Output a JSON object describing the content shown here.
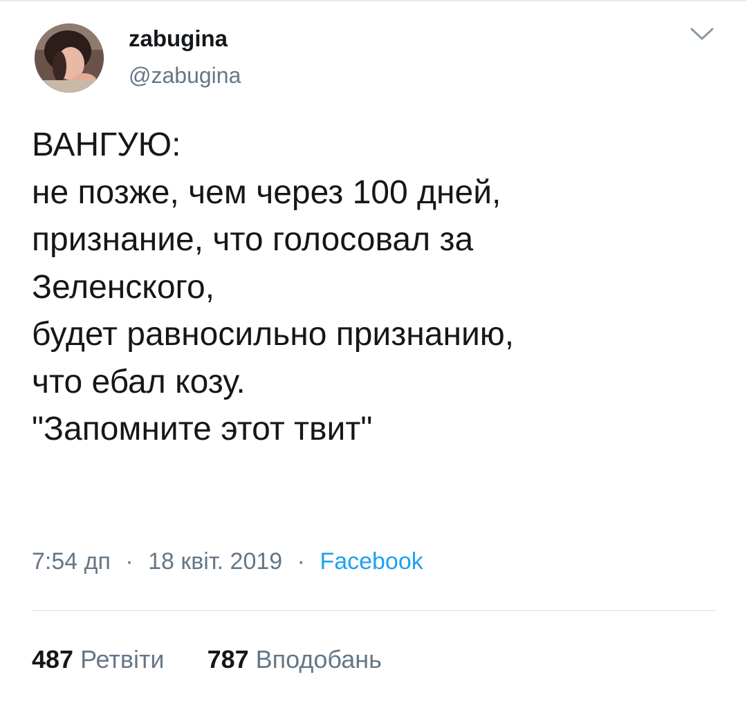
{
  "tweet": {
    "author": {
      "display_name": "zabugina",
      "handle": "@zabugina"
    },
    "text_lines": [
      "ВАНГУЮ:",
      "не  позже, чем через 100 дней,",
      "признание, что голосовал за",
      "Зеленского,",
      "будет равносильно признанию,",
      "что ебал козу.",
      "\"Запомните этот твит\""
    ],
    "time": "7:54 дп",
    "date": "18 квіт. 2019",
    "separator": "·",
    "source": "Facebook",
    "retweets": {
      "count": "487",
      "label": "Ретвіти"
    },
    "likes": {
      "count": "787",
      "label": "Вподобань"
    }
  },
  "colors": {
    "text": "#14171a",
    "secondary": "#657786",
    "link": "#1da1f2",
    "divider": "#e6ecf0"
  },
  "icons": {
    "menu": "chevron-down-icon",
    "avatar": "profile-photo"
  }
}
